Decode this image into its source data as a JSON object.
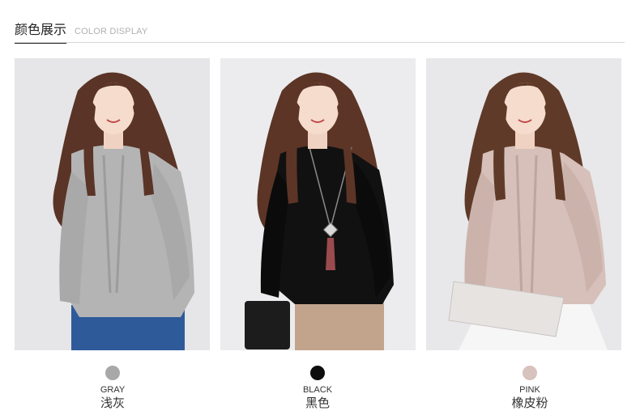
{
  "header": {
    "title": "颜色展示",
    "subtitle": "COLOR DISPLAY"
  },
  "colors": [
    {
      "en": "GRAY",
      "cn": "浅灰",
      "swatch": "#a8a8a8"
    },
    {
      "en": "BLACK",
      "cn": "黑色",
      "swatch": "#0d0d0d"
    },
    {
      "en": "PINK",
      "cn": "橡皮粉",
      "swatch": "#d7c2bd"
    }
  ]
}
